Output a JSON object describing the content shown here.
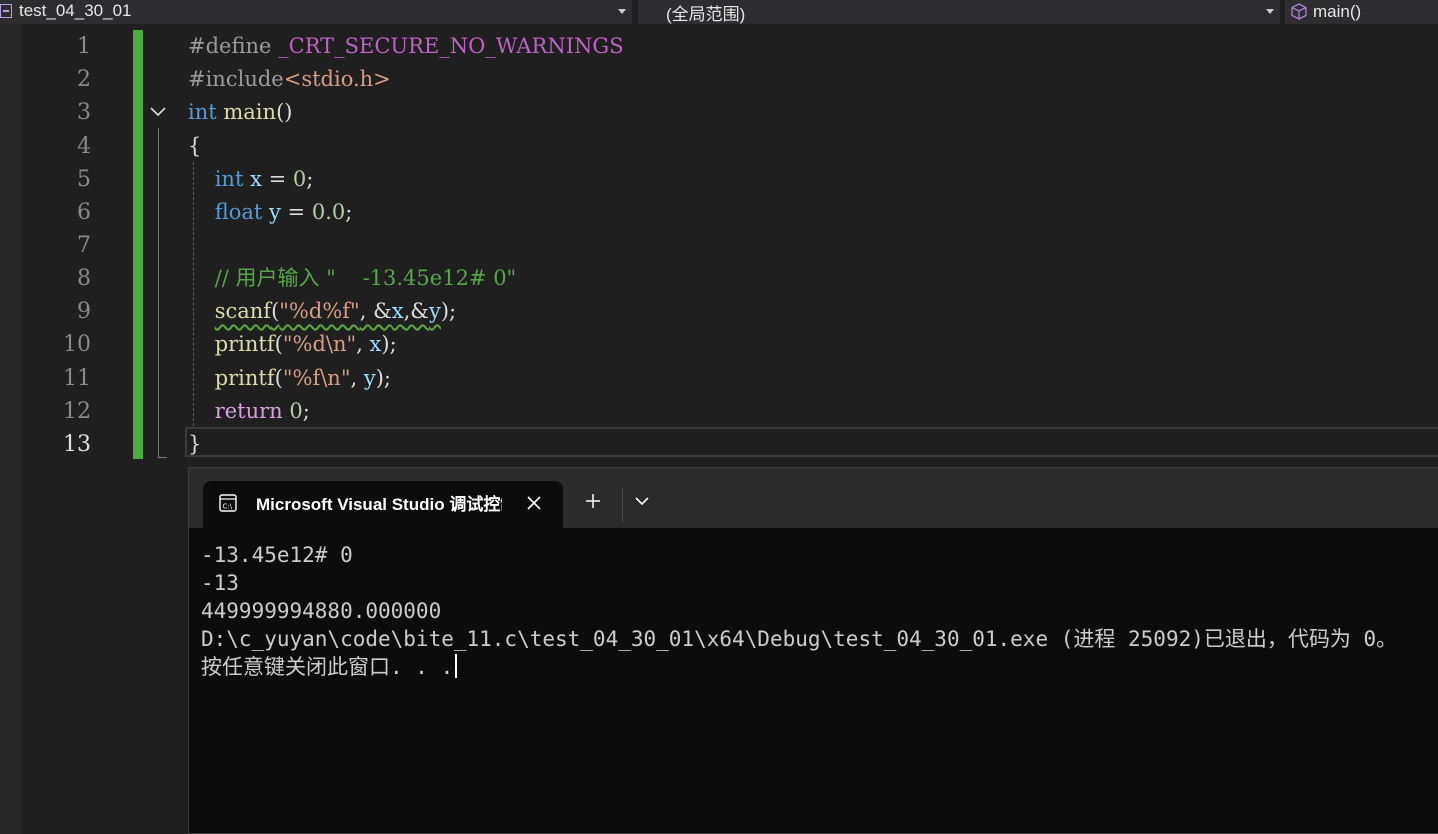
{
  "navbar": {
    "project": "test_04_30_01",
    "scope": "(全局范围)",
    "member": "main()"
  },
  "editor": {
    "line_numbers": [
      "1",
      "2",
      "3",
      "4",
      "5",
      "6",
      "7",
      "8",
      "9",
      "10",
      "11",
      "12",
      "13"
    ],
    "current_line": 13,
    "lines": {
      "l1": {
        "directive": "#define",
        "macro": "_CRT_SECURE_NO_WARNINGS"
      },
      "l2": {
        "directive": "#include",
        "header": "<stdio.h>"
      },
      "l3": {
        "type": "int",
        "name": "main",
        "paren": "()"
      },
      "l4": {
        "brace": "{"
      },
      "l5": {
        "type": "int",
        "var": "x",
        "op": " = ",
        "num": "0",
        "end": ";"
      },
      "l6": {
        "type": "float",
        "var": "y",
        "op": " = ",
        "num": "0.0",
        "end": ";"
      },
      "l8": {
        "comment": "// 用户输入 \"    -13.45e12# 0\""
      },
      "l9": {
        "fn": "scanf",
        "open": "(",
        "str": "\"%d%f\"",
        "sep1": ", &",
        "v1": "x",
        "sep2": ",&",
        "v2": "y",
        "close": ");"
      },
      "l10": {
        "fn": "printf",
        "open": "(",
        "str": "\"%d\\n\"",
        "sep": ", ",
        "v": "x",
        "close": ");"
      },
      "l11": {
        "fn": "printf",
        "open": "(",
        "str": "\"%f\\n\"",
        "sep": ", ",
        "v": "y",
        "close": ");"
      },
      "l12": {
        "kw": "return",
        "num": "0",
        "end": ";"
      },
      "l13": {
        "brace": "}"
      }
    }
  },
  "console": {
    "tab_title": "Microsoft Visual Studio 调试控制台",
    "output": [
      "-13.45e12# 0",
      "-13",
      "449999994880.000000",
      "",
      "D:\\c_yuyan\\code\\bite_11.c\\test_04_30_01\\x64\\Debug\\test_04_30_01.exe (进程 25092)已退出，代码为 0。",
      "按任意键关闭此窗口. . ."
    ]
  }
}
